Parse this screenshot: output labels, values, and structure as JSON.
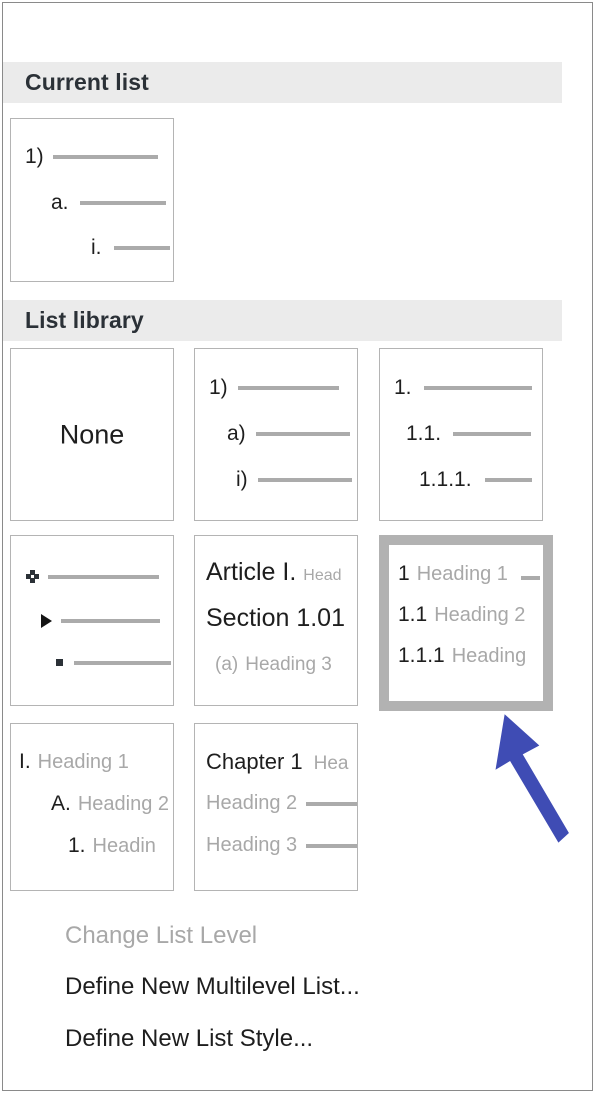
{
  "panel": {
    "accent_selected_border": "#b2b2b2",
    "header_bg": "#ebebeb",
    "arrow_color": "#3f4cb4"
  },
  "current_list": {
    "header": "Current list",
    "preview": {
      "levels": [
        {
          "marker": "1)",
          "indent": 0
        },
        {
          "marker": "a.",
          "indent": 1
        },
        {
          "marker": "i.",
          "indent": 2
        }
      ]
    }
  },
  "list_library": {
    "header": "List library",
    "items": [
      {
        "id": "none",
        "kind": "none",
        "label": "None",
        "selected": false
      },
      {
        "id": "paren-number",
        "kind": "lines",
        "selected": false,
        "levels": [
          {
            "marker": "1)",
            "indent": 0
          },
          {
            "marker": "a)",
            "indent": 1
          },
          {
            "marker": "i)",
            "indent": 2
          }
        ]
      },
      {
        "id": "legal-number",
        "kind": "lines",
        "selected": false,
        "levels": [
          {
            "marker": "1.",
            "indent": 0
          },
          {
            "marker": "1.1.",
            "indent": 1
          },
          {
            "marker": "1.1.1.",
            "indent": 2
          }
        ]
      },
      {
        "id": "bullets",
        "kind": "bullets",
        "selected": false,
        "levels": [
          {
            "bullet": "diamond-bullet-icon",
            "indent": 0
          },
          {
            "bullet": "triangle-bullet-icon",
            "indent": 1
          },
          {
            "bullet": "square-bullet-icon",
            "indent": 2
          }
        ]
      },
      {
        "id": "article-section",
        "kind": "headings",
        "selected": false,
        "levels": [
          {
            "marker": "Article I.",
            "text": "Head"
          },
          {
            "marker": "Section 1.01",
            "text": ""
          },
          {
            "marker": "(a)",
            "text": "Heading 3"
          }
        ]
      },
      {
        "id": "numbered-headings",
        "kind": "headings",
        "selected": true,
        "levels": [
          {
            "marker": "1",
            "text": "Heading 1"
          },
          {
            "marker": "1.1",
            "text": "Heading 2"
          },
          {
            "marker": "1.1.1",
            "text": "Heading"
          }
        ]
      },
      {
        "id": "roman-headings",
        "kind": "headings",
        "selected": false,
        "levels": [
          {
            "marker": "I.",
            "text": "Heading 1"
          },
          {
            "marker": "A.",
            "text": "Heading 2"
          },
          {
            "marker": "1.",
            "text": "Headin"
          }
        ]
      },
      {
        "id": "chapter-headings",
        "kind": "headings",
        "selected": false,
        "levels": [
          {
            "marker": "Chapter 1",
            "text": "Hea"
          },
          {
            "marker": "Heading 2",
            "text": ""
          },
          {
            "marker": "Heading 3",
            "text": ""
          }
        ]
      }
    ]
  },
  "menu": {
    "items": [
      {
        "label": "Change List Level",
        "disabled": true
      },
      {
        "label": "Define New Multilevel List...",
        "disabled": false
      },
      {
        "label": "Define New List Style...",
        "disabled": false
      }
    ]
  }
}
